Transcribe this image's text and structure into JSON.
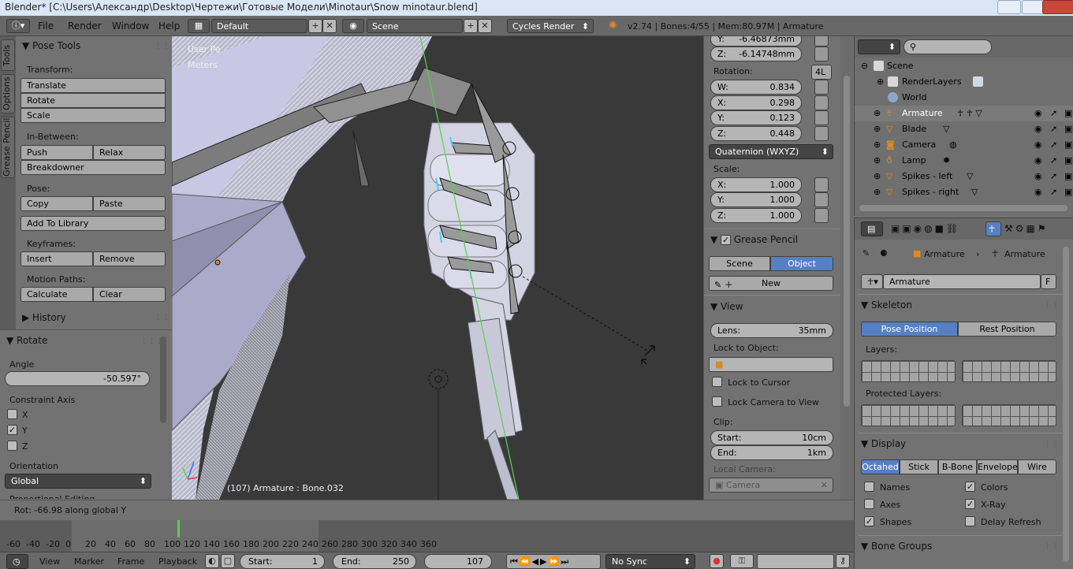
{
  "window": {
    "title": "Blender* [C:\\Users\\Александр\\Desktop\\Чертежи\\Готовые Модели\\Minotaur\\Snow minotaur.blend]"
  },
  "menu": {
    "items": [
      "File",
      "Render",
      "Window",
      "Help"
    ]
  },
  "header": {
    "layout": "Default",
    "scene": "Scene",
    "engine": "Cycles Render",
    "info": "v2.74 | Bones:4/55 | Mem:80.97M | Armature"
  },
  "tabs": [
    "Tools",
    "Options",
    "Grease Pencil"
  ],
  "pose_tools": {
    "title": "Pose Tools",
    "transform_label": "Transform:",
    "translate": "Translate",
    "rotate": "Rotate",
    "scale": "Scale",
    "inbetween_label": "In-Between:",
    "push": "Push",
    "relax": "Relax",
    "breakdowner": "Breakdowner",
    "pose_label": "Pose:",
    "copy": "Copy",
    "paste": "Paste",
    "add_to_library": "Add To Library",
    "keyframes_label": "Keyframes:",
    "insert": "Insert",
    "remove": "Remove",
    "motion_paths_label": "Motion Paths:",
    "calculate": "Calculate",
    "clear": "Clear",
    "history": "History"
  },
  "operator": {
    "title": "Rotate",
    "angle_label": "Angle",
    "angle_value": "-50.597°",
    "constraint_label": "Constraint Axis",
    "axis_x": "X",
    "axis_y": "Y",
    "axis_z": "Z",
    "orientation_label": "Orientation",
    "orientation_value": "Global",
    "proportional": "Proportional Editing"
  },
  "viewport": {
    "view_name": "User Pe",
    "units": "Meters",
    "status": "(107) Armature : Bone.032"
  },
  "npanel": {
    "loc_y_label": "Y:",
    "loc_y": "-6.46873mm",
    "loc_z_label": "Z:",
    "loc_z": "-6.14748mm",
    "rotation_label": "Rotation:",
    "rotation_lock": "4L",
    "rot_w_label": "W:",
    "rot_w": "0.834",
    "rot_x_label": "X:",
    "rot_x": "0.298",
    "rot_y_label": "Y:",
    "rot_y": "0.123",
    "rot_z_label": "Z:",
    "rot_z": "0.448",
    "rotation_mode": "Quaternion (WXYZ)",
    "scale_label": "Scale:",
    "scale_x_label": "X:",
    "scale_x": "1.000",
    "scale_y_label": "Y:",
    "scale_y": "1.000",
    "scale_z_label": "Z:",
    "scale_z": "1.000",
    "grease_pencil": "Grease Pencil",
    "gp_scene": "Scene",
    "gp_object": "Object",
    "gp_new": "New",
    "view_title": "View",
    "lens_label": "Lens:",
    "lens_value": "35mm",
    "lock_to_object": "Lock to Object:",
    "lock_to_cursor": "Lock to Cursor",
    "lock_camera": "Lock Camera to View",
    "clip_label": "Clip:",
    "clip_start_label": "Start:",
    "clip_start": "10cm",
    "clip_end_label": "End:",
    "clip_end": "1km",
    "local_camera": "Local Camera:",
    "camera": "Camera"
  },
  "outliner": {
    "rows": [
      {
        "name": "Scene"
      },
      {
        "name": "RenderLayers"
      },
      {
        "name": "World"
      },
      {
        "name": "Armature"
      },
      {
        "name": "Blade"
      },
      {
        "name": "Camera"
      },
      {
        "name": "Lamp"
      },
      {
        "name": "Spikes - left"
      },
      {
        "name": "Spikes - right"
      }
    ]
  },
  "props": {
    "crumb1": "Armature",
    "crumb2": "Armature",
    "datablock": "Armature",
    "fake_user": "F",
    "skeleton": "Skeleton",
    "pose_position": "Pose Position",
    "rest_position": "Rest Position",
    "layers_label": "Layers:",
    "protected_layers_label": "Protected Layers:",
    "display": "Display",
    "display_modes": [
      "Octahed",
      "Stick",
      "B-Bone",
      "Envelope",
      "Wire"
    ],
    "names": "Names",
    "colors": "Colors",
    "axes": "Axes",
    "xray": "X-Ray",
    "shapes": "Shapes",
    "delay_refresh": "Delay Refresh",
    "bone_groups": "Bone Groups"
  },
  "status": {
    "text": "Rot: -66.98 along global Y"
  },
  "timeline": {
    "ticks": [
      "-60",
      "-40",
      "-20",
      "0",
      "20",
      "40",
      "60",
      "80",
      "100",
      "120",
      "140",
      "160",
      "180",
      "200",
      "220",
      "240",
      "260",
      "280",
      "300",
      "320",
      "340",
      "360"
    ],
    "current_frame": 107,
    "range_start": 0,
    "range_end": 250
  },
  "timeline_header": {
    "view": "View",
    "marker": "Marker",
    "frame": "Frame",
    "playback": "Playback",
    "start_label": "Start:",
    "start": "1",
    "end_label": "End:",
    "end": "250",
    "current": "107",
    "sync": "No Sync"
  }
}
